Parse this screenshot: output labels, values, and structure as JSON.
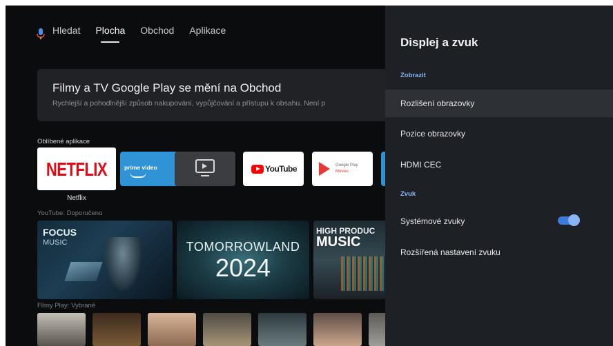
{
  "nav": {
    "tabs": [
      {
        "label": "Hledat"
      },
      {
        "label": "Plocha"
      },
      {
        "label": "Obchod"
      },
      {
        "label": "Aplikace"
      }
    ]
  },
  "banner": {
    "title": "Filmy a TV Google Play se mění na Obchod",
    "subtitle": "Rychlejší a pohodlnější způsob nakupování, vypůjčování a přístupu k obsahu. Není p"
  },
  "favorites": {
    "label": "Oblíbené aplikace",
    "apps": [
      {
        "name": "Netflix",
        "logo_text": "NETFLIX"
      },
      {
        "logo_text": "prime video"
      },
      {
        "icon": "player-icon"
      },
      {
        "logo_text": "YouTube"
      },
      {
        "logo_line1": "Google Play",
        "logo_line2": "Movies"
      }
    ]
  },
  "youtube_section": {
    "label": "YouTube: Doporučeno",
    "items": [
      {
        "line1": "FOCUS",
        "line2": "MUSIC"
      },
      {
        "line1": "TOMORROWLAND",
        "line2": "2024"
      },
      {
        "line1": "HIGH PRODUC",
        "line2": "MUSIC"
      }
    ]
  },
  "movies_section": {
    "label": "Filmy Play: Vybrané"
  },
  "panel": {
    "title": "Displej a zvuk",
    "display_category": "Zobrazit",
    "display_items": [
      {
        "label": "Rozlišení obrazovky"
      },
      {
        "label": "Pozice obrazovky"
      },
      {
        "label": "HDMI CEC"
      }
    ],
    "sound_category": "Zvuk",
    "sound_items": [
      {
        "label": "Systémové zvuky",
        "toggle": true
      },
      {
        "label": "Rozšířená nastavení zvuku"
      }
    ]
  },
  "colors": {
    "accent": "#8ab4f8",
    "netflix_red": "#e50914",
    "panel_bg": "#1d2126"
  }
}
